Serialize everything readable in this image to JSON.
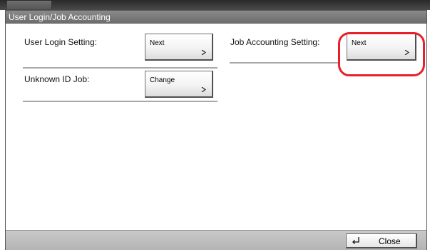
{
  "window": {
    "title": "User Login/Job Accounting"
  },
  "settings": {
    "user_login": {
      "label": "User Login Setting:",
      "button_label": "Next"
    },
    "job_accounting": {
      "label": "Job Accounting Setting:",
      "button_label": "Next",
      "highlighted": true
    },
    "unknown_id_job": {
      "label": "Unknown ID Job:",
      "button_label": "Change"
    }
  },
  "footer": {
    "close_label": "Close",
    "close_icon": "return-arrow-icon"
  },
  "colors": {
    "highlight": "#e8202a",
    "title_bar": "#7a7a7a",
    "footer": "#bdbdbd"
  }
}
